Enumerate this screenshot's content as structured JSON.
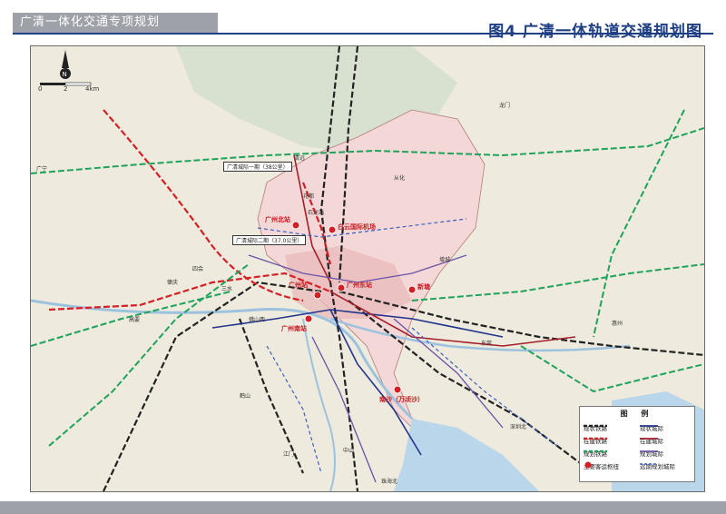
{
  "header": {
    "doc_title": "广清一体化交通专项规划"
  },
  "map": {
    "title": "图4   广清一体轨道交通规划图",
    "scale": {
      "zero": "0",
      "mid": "2",
      "end": "4km"
    },
    "compass_letter": "N",
    "callouts": [
      "广清城际一期（38公里）",
      "广清城际二期（37.0公里）"
    ],
    "stations": [
      "广州北站",
      "白云国际机场",
      "广州东站",
      "新塘",
      "广州南站",
      "南沙（万顷沙）",
      "广州站"
    ],
    "places": [
      "石龙站",
      "佛山西",
      "龙门",
      "从化",
      "增城",
      "清远",
      "花都",
      "三水",
      "肇庆",
      "东莞",
      "深圳北",
      "惠州",
      "江门",
      "中山",
      "珠海北",
      "广宁",
      "四会",
      "高要",
      "鹤山"
    ],
    "legend": {
      "title": "图 例",
      "items": [
        {
          "label": "现状铁路",
          "color": "#222222",
          "style": "rail"
        },
        {
          "label": "在建铁路",
          "color": "#d42025",
          "style": "rail"
        },
        {
          "label": "规划铁路",
          "color": "#1fa35a",
          "style": "rail"
        },
        {
          "label": "主要客运枢纽",
          "color": "#d42025",
          "style": "dot"
        },
        {
          "label": "现状城际",
          "color": "#22338c",
          "style": "solid"
        },
        {
          "label": "在建城际",
          "color": "#a31f2a",
          "style": "solid"
        },
        {
          "label": "规划城际",
          "color": "#6a52a8",
          "style": "solid"
        },
        {
          "label": "远期规划城际",
          "color": "#3b5fc0",
          "style": "dash"
        }
      ]
    }
  }
}
